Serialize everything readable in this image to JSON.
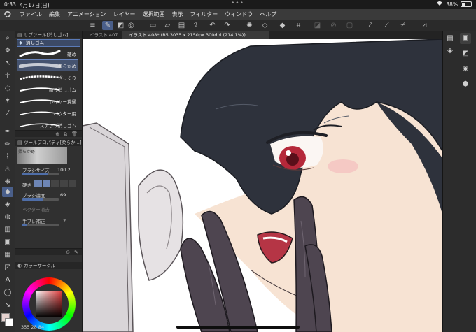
{
  "status": {
    "time": "0:33",
    "date": "4月17日(日)",
    "battery": "38%",
    "multitask_dots": "•••"
  },
  "menu": {
    "items": [
      "ファイル",
      "編集",
      "アニメーション",
      "レイヤー",
      "選択範囲",
      "表示",
      "フィルター",
      "ウィンドウ",
      "ヘルプ"
    ]
  },
  "toolbar": {
    "icons": [
      "menu-icon",
      "pen-icon",
      "color-icon",
      "new-file-icon",
      "open-icon",
      "save-icon",
      "export-icon",
      "undo-icon",
      "redo-icon",
      "loading-icon",
      "fill-icon",
      "transform-icon",
      "crop-icon",
      "clear-icon",
      "deselect-icon",
      "select-all-icon",
      "invert-icon",
      "pen-settings-icon",
      "brush-settings-icon",
      "eraser-settings-icon",
      "ruler-icon"
    ]
  },
  "tabs": {
    "inactive": "イラスト 407",
    "active": "イラスト 408* (B5 3035 x 2150px 300dpi (214.1%))"
  },
  "subtool": {
    "header": "サブツール[消しゴム]",
    "group_tab": "消しゴム",
    "brushes": [
      {
        "label": "硬め"
      },
      {
        "label": "柔らかめ"
      },
      {
        "label": "ざっくり"
      },
      {
        "label": "練り消しゴム"
      },
      {
        "label": "レイヤー貫通"
      },
      {
        "label": "ベクター用"
      },
      {
        "label": "スナップ消しゴム"
      }
    ]
  },
  "tool_property": {
    "header": "ツールプロパティ[柔らか...]",
    "preview_label": "柔らかめ",
    "brush_size_label": "ブラシサイズ",
    "brush_size_value": "100.2",
    "hardness_label": "硬さ",
    "density_label": "ブラシ濃度",
    "density_value": "69",
    "vector_label": "ベクター消去",
    "stabilization_label": "手ブレ補正",
    "stabilization_value": "2"
  },
  "color": {
    "header": "カラーサークル",
    "readout": "355 28 84",
    "main_color": "#e5d2cf",
    "sub_color": "#ffffff"
  },
  "colors": {
    "accent": "#4a5f8a",
    "hair": "#2e323c",
    "skin": "#f7e3d3",
    "glove": "#4e4550",
    "eye": "#b5283a"
  }
}
